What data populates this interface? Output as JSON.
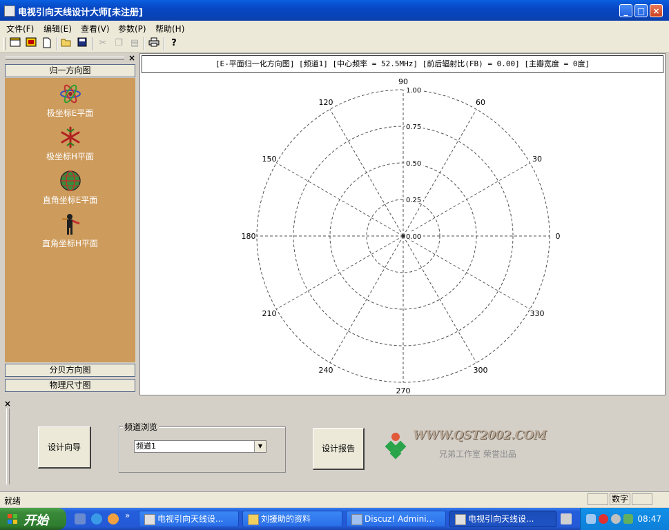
{
  "window": {
    "title": "电视引向天线设计大师[未注册]",
    "min": "_",
    "max": "□",
    "close": "×"
  },
  "menu": [
    "文件(F)",
    "编辑(E)",
    "查看(V)",
    "参数(P)",
    "帮助(H)"
  ],
  "toolbar": {
    "icons": [
      "window-icon",
      "d-icon",
      "new-file-icon",
      "open-folder-icon",
      "save-icon",
      "cut-icon",
      "copy-icon",
      "paste-icon",
      "print-icon",
      "help-icon"
    ]
  },
  "left_panel": {
    "close": "×",
    "header_top": "归一方向图",
    "items": [
      {
        "label": "极坐标E平面",
        "icon": "atom-icon"
      },
      {
        "label": "极坐标H平面",
        "icon": "snowflake-icon"
      },
      {
        "label": "直角坐标E平面",
        "icon": "globe-icon"
      },
      {
        "label": "直角坐标H平面",
        "icon": "person-icon"
      }
    ],
    "header_mid": "分贝方向图",
    "header_bottom": "物理尺寸图"
  },
  "chart": {
    "header": "[E-平面归一化方向图] [频道1] [中心频率 = 52.5MHz] [前后辐射比(FB) = 0.00] [主瓣宽度 = 0度]"
  },
  "chart_data": {
    "type": "polar",
    "title": "[E-平面归一化方向图] [频道1] [中心频率 = 52.5MHz] [前后辐射比(FB) = 0.00] [主瓣宽度 = 0度]",
    "angle_ticks": [
      0,
      30,
      60,
      90,
      120,
      150,
      180,
      210,
      240,
      270,
      300,
      330
    ],
    "angle_labels": [
      "0",
      "30",
      "60",
      "90",
      "120",
      "150",
      "180",
      "210",
      "240",
      "270",
      "300",
      "330"
    ],
    "radial_ticks": [
      0.25,
      0.5,
      0.75,
      1.0
    ],
    "radial_labels": [
      "0.00",
      "0.25",
      "0.50",
      "0.75",
      "1.00"
    ],
    "rlim": [
      0,
      1
    ],
    "grid": true,
    "series": []
  },
  "bottom_panel": {
    "close": "×",
    "wizard_button": "设计向导",
    "group_label": "频道浏览",
    "channel_select": "频道1",
    "report_button": "设计报告",
    "logo_url": "WWW.QST2002.COM",
    "logo_sub": "兄弟工作室 荣誉出品"
  },
  "status": {
    "text": "就绪",
    "num": "数字"
  },
  "taskbar": {
    "start": "开始",
    "chevron": "»",
    "tasks": [
      {
        "label": "电视引向天线设...",
        "active": false
      },
      {
        "label": "刘援助的资料",
        "active": false
      },
      {
        "label": "Discuz! Admini...",
        "active": false
      },
      {
        "label": "电视引向天线设...",
        "active": true
      }
    ],
    "clock": "08:47"
  }
}
